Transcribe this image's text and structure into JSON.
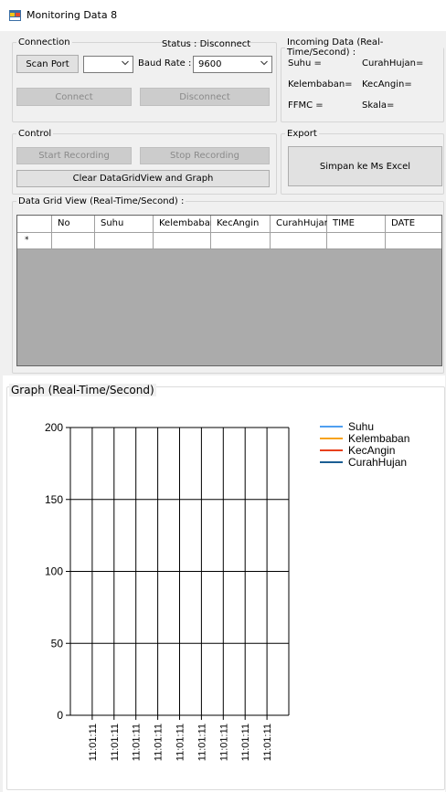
{
  "window": {
    "title": "Monitoring Data 8"
  },
  "connection": {
    "legend": "Connection",
    "status_text": "Status : Disconnect",
    "scan_port_label": "Scan Port",
    "port_value": "",
    "baud_rate_label": "Baud Rate :",
    "baud_rate_value": "9600",
    "connect_label": "Connect",
    "disconnect_label": "Disconnect"
  },
  "incoming": {
    "legend": "Incoming Data (Real-Time/Second) :",
    "suhu": "Suhu =",
    "curah_hujan": "CurahHujan=",
    "kelembaban": "Kelembaban=",
    "kec_angin": "KecAngin=",
    "ffmc": "FFMC =",
    "skala": "Skala="
  },
  "control": {
    "legend": "Control",
    "start_label": "Start Recording",
    "stop_label": "Stop Recording",
    "clear_label": "Clear DataGridView and Graph"
  },
  "export": {
    "legend": "Export",
    "excel_label": "Simpan ke Ms Excel"
  },
  "grid": {
    "title": "Data Grid View (Real-Time/Second) :",
    "columns": [
      "No",
      "Suhu",
      "Kelembaban",
      "KecAngin",
      "CurahHujan",
      "TIME",
      "DATE"
    ],
    "new_row_marker": "*"
  },
  "graph": {
    "title": "Graph (Real-Time/Second)"
  },
  "chart_data": {
    "type": "line",
    "title": "",
    "xlabel": "",
    "ylabel": "",
    "ylim": [
      0,
      200
    ],
    "yticks": [
      0,
      50,
      100,
      150,
      200
    ],
    "x": [
      "11:01:11",
      "11:01:11",
      "11:01:11",
      "11:01:11",
      "11:01:11",
      "11:01:11",
      "11:01:11",
      "11:01:11",
      "11:01:11"
    ],
    "grid": true,
    "legend_position": "top-right",
    "series": [
      {
        "name": "Suhu",
        "color": "#4f9ff0",
        "values": []
      },
      {
        "name": "Kelembaban",
        "color": "#f7a21b",
        "values": []
      },
      {
        "name": "KecAngin",
        "color": "#e8401c",
        "values": []
      },
      {
        "name": "CurahHujan",
        "color": "#1b5e93",
        "values": []
      }
    ]
  }
}
